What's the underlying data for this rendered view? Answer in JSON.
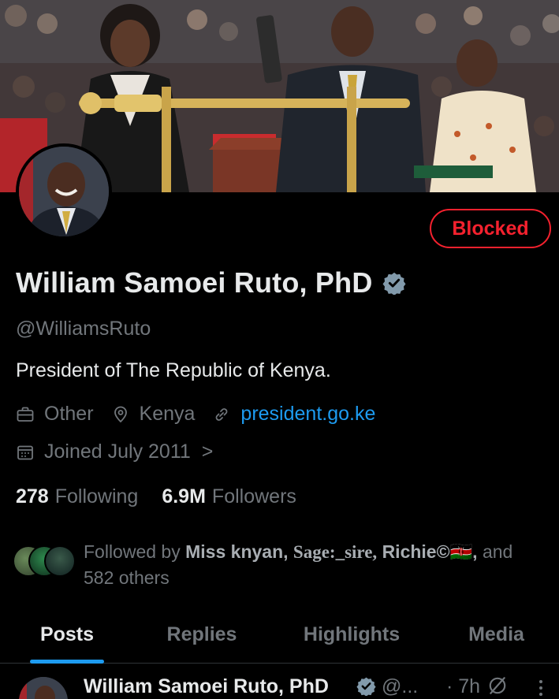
{
  "profile": {
    "name": "William Samoei Ruto, PhD",
    "handle": "@WilliamsRuto",
    "bio": "President of The Republic of Kenya.",
    "category": "Other",
    "location": "Kenya",
    "website": "president.go.ke",
    "joined": "Joined July 2011",
    "joined_chevron": ">",
    "following_count": "278",
    "following_label": "Following",
    "followers_count": "6.9M",
    "followers_label": "Followers"
  },
  "actions": {
    "blocked_label": "Blocked"
  },
  "followed_by": {
    "prefix": "Followed by",
    "names": [
      "Miss knyan,",
      "Sage:_sire,",
      "Richie©🇰🇪,"
    ],
    "suffix": "and",
    "others": "582 others"
  },
  "tabs": [
    {
      "label": "Posts",
      "active": true
    },
    {
      "label": "Replies",
      "active": false
    },
    {
      "label": "Highlights",
      "active": false
    },
    {
      "label": "Media",
      "active": false
    }
  ],
  "post": {
    "author": "William Samoei Ruto, PhD",
    "handle": "@...",
    "time": "· 7h"
  },
  "colors": {
    "background": "#000000",
    "primary_text": "#e7e9ea",
    "secondary_text": "#71767b",
    "link": "#1d9bf0",
    "blocked_red": "#f4212e",
    "verified_badge": "#829aab"
  },
  "icons": {
    "category": "briefcase-icon",
    "location": "location-pin-icon",
    "website": "link-icon",
    "joined": "calendar-icon",
    "verified": "verified-badge-icon",
    "grok": "grok-icon",
    "more": "more-vertical-icon"
  }
}
